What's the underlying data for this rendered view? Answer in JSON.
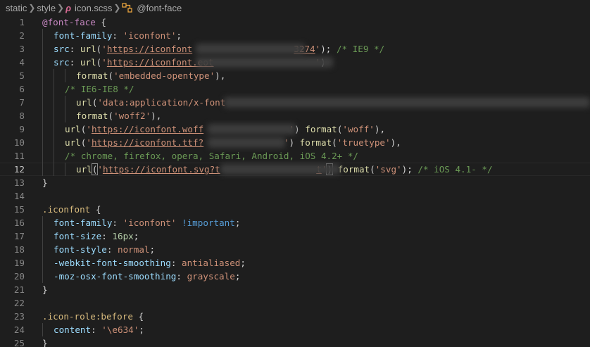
{
  "breadcrumb": {
    "items": [
      "static",
      "style",
      "icon.scss",
      "@font-face"
    ],
    "file_icon": "sass-file-icon",
    "symbol_icon": "symbol-structure-icon"
  },
  "editor": {
    "current_line": 12,
    "lines": [
      {
        "n": "1",
        "indent": 0,
        "t": [
          [
            "@font-face",
            "at"
          ],
          [
            " {",
            "punc"
          ]
        ]
      },
      {
        "n": "2",
        "indent": 1,
        "t": [
          [
            "font-family",
            "prop"
          ],
          [
            ": ",
            "punc"
          ],
          [
            "'iconfont'",
            "str"
          ],
          [
            ";",
            "punc"
          ]
        ]
      },
      {
        "n": "3",
        "indent": 1,
        "t": [
          [
            "src",
            "prop"
          ],
          [
            ": ",
            "punc"
          ],
          [
            "url",
            "fn"
          ],
          [
            "(",
            "punc"
          ],
          [
            "'",
            "str"
          ],
          [
            "https://iconfont",
            "url"
          ],
          [
            "                   ",
            "str"
          ],
          [
            "3274",
            "url"
          ],
          [
            "'",
            "str"
          ],
          [
            "); ",
            "punc"
          ],
          [
            "/* IE9 */",
            "cmt"
          ]
        ]
      },
      {
        "n": "4",
        "indent": 1,
        "t": [
          [
            "src",
            "prop"
          ],
          [
            ": ",
            "punc"
          ],
          [
            "url",
            "fn"
          ],
          [
            "(",
            "punc"
          ],
          [
            "'",
            "str"
          ],
          [
            "https://iconfont.eot",
            "url"
          ],
          [
            "                   ",
            "str"
          ],
          [
            "'",
            "str"
          ],
          [
            ")",
            "punc"
          ]
        ]
      },
      {
        "n": "5",
        "indent": 3,
        "t": [
          [
            "format",
            "fn"
          ],
          [
            "(",
            "punc"
          ],
          [
            "'embedded-opentype'",
            "str"
          ],
          [
            "),",
            "punc"
          ]
        ]
      },
      {
        "n": "6",
        "indent": 2,
        "t": [
          [
            "/* IE6-IE8 */",
            "cmt"
          ]
        ]
      },
      {
        "n": "7",
        "indent": 3,
        "t": [
          [
            "url",
            "fn"
          ],
          [
            "(",
            "punc"
          ],
          [
            "'data:application/x-font",
            "str"
          ]
        ]
      },
      {
        "n": "8",
        "indent": 3,
        "t": [
          [
            "format",
            "fn"
          ],
          [
            "(",
            "punc"
          ],
          [
            "'woff2'",
            "str"
          ],
          [
            "),",
            "punc"
          ]
        ]
      },
      {
        "n": "9",
        "indent": 2,
        "t": [
          [
            "url",
            "fn"
          ],
          [
            "(",
            "punc"
          ],
          [
            "'",
            "str"
          ],
          [
            "https://iconfont.woff",
            "url"
          ],
          [
            "                ",
            "str"
          ],
          [
            "'",
            "str"
          ],
          [
            ") ",
            "punc"
          ],
          [
            "format",
            "fn"
          ],
          [
            "(",
            "punc"
          ],
          [
            "'woff'",
            "str"
          ],
          [
            "),",
            "punc"
          ]
        ]
      },
      {
        "n": "10",
        "indent": 2,
        "t": [
          [
            "url",
            "fn"
          ],
          [
            "(",
            "punc"
          ],
          [
            "'",
            "str"
          ],
          [
            "https://iconfont.ttf?",
            "url"
          ],
          [
            "               ",
            "str"
          ],
          [
            "'",
            "str"
          ],
          [
            ") ",
            "punc"
          ],
          [
            "format",
            "fn"
          ],
          [
            "(",
            "punc"
          ],
          [
            "'truetype'",
            "str"
          ],
          [
            "),",
            "punc"
          ]
        ]
      },
      {
        "n": "11",
        "indent": 2,
        "t": [
          [
            "/* chrome, firefox, opera, Safari, Android, iOS 4.2+ */",
            "cmt"
          ]
        ]
      },
      {
        "n": "12",
        "indent": 3,
        "t": [
          [
            "url",
            "fn"
          ],
          [
            "(",
            "bracket"
          ],
          [
            "'",
            "str"
          ],
          [
            "https://iconfont.svg?t",
            "url"
          ],
          [
            "                  ",
            "str"
          ],
          [
            "t",
            "url"
          ],
          [
            "'",
            "str"
          ],
          [
            ")",
            "bracket"
          ],
          [
            " ",
            "punc"
          ],
          [
            "format",
            "fn"
          ],
          [
            "(",
            "punc"
          ],
          [
            "'svg'",
            "str"
          ],
          [
            "); ",
            "punc"
          ],
          [
            "/* iOS 4.1- */",
            "cmt"
          ]
        ]
      },
      {
        "n": "13",
        "indent": 0,
        "t": [
          [
            "}",
            "punc"
          ]
        ]
      },
      {
        "n": "14",
        "indent": 0,
        "t": []
      },
      {
        "n": "15",
        "indent": 0,
        "t": [
          [
            ".iconfont",
            "sel"
          ],
          [
            " {",
            "punc"
          ]
        ]
      },
      {
        "n": "16",
        "indent": 1,
        "t": [
          [
            "font-family",
            "prop"
          ],
          [
            ": ",
            "punc"
          ],
          [
            "'iconfont'",
            "str"
          ],
          [
            " ",
            "punc"
          ],
          [
            "!important",
            "kw"
          ],
          [
            ";",
            "punc"
          ]
        ]
      },
      {
        "n": "17",
        "indent": 1,
        "t": [
          [
            "font-size",
            "prop"
          ],
          [
            ": ",
            "punc"
          ],
          [
            "16px",
            "num"
          ],
          [
            ";",
            "punc"
          ]
        ]
      },
      {
        "n": "18",
        "indent": 1,
        "t": [
          [
            "font-style",
            "prop"
          ],
          [
            ": ",
            "punc"
          ],
          [
            "normal",
            "str"
          ],
          [
            ";",
            "punc"
          ]
        ]
      },
      {
        "n": "19",
        "indent": 1,
        "t": [
          [
            "-webkit-font-smoothing",
            "prop"
          ],
          [
            ": ",
            "punc"
          ],
          [
            "antialiased",
            "str"
          ],
          [
            ";",
            "punc"
          ]
        ]
      },
      {
        "n": "20",
        "indent": 1,
        "t": [
          [
            "-moz-osx-font-smoothing",
            "prop"
          ],
          [
            ": ",
            "punc"
          ],
          [
            "grayscale",
            "str"
          ],
          [
            ";",
            "punc"
          ]
        ]
      },
      {
        "n": "21",
        "indent": 0,
        "t": [
          [
            "}",
            "punc"
          ]
        ]
      },
      {
        "n": "22",
        "indent": 0,
        "t": []
      },
      {
        "n": "23",
        "indent": 0,
        "t": [
          [
            ".icon-role:before",
            "sel"
          ],
          [
            " {",
            "punc"
          ]
        ]
      },
      {
        "n": "24",
        "indent": 1,
        "t": [
          [
            "content",
            "prop"
          ],
          [
            ": ",
            "punc"
          ],
          [
            "'\\e634'",
            "str"
          ],
          [
            ";",
            "punc"
          ]
        ]
      },
      {
        "n": "25",
        "indent": 0,
        "t": [
          [
            "}",
            "punc"
          ]
        ]
      }
    ]
  }
}
